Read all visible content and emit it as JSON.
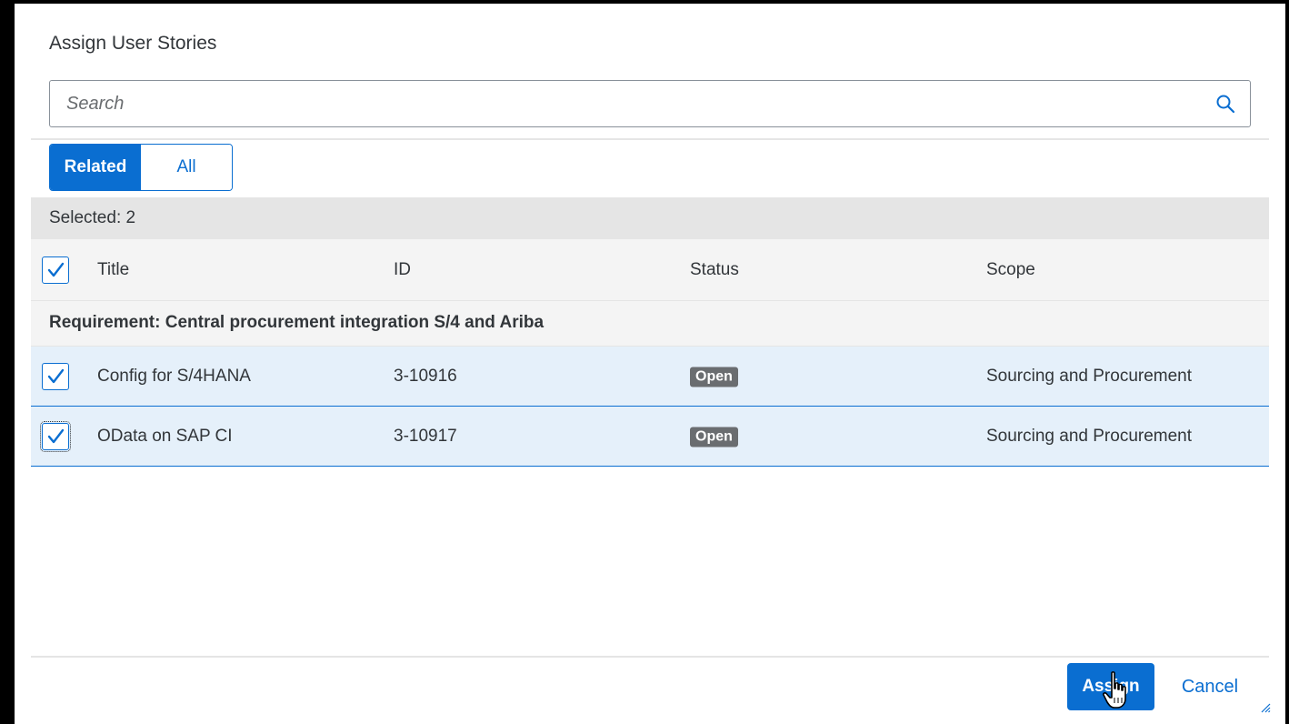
{
  "dialog": {
    "title": "Assign User Stories"
  },
  "search": {
    "placeholder": "Search",
    "value": ""
  },
  "filter": {
    "segments": [
      "Related",
      "All"
    ],
    "selected": "Related"
  },
  "selection": {
    "label": "Selected: 2"
  },
  "table": {
    "columns": {
      "title": "Title",
      "id": "ID",
      "status": "Status",
      "scope": "Scope"
    },
    "select_all_checked": true,
    "group": {
      "label": "Requirement: Central procurement integration S/4 and Ariba"
    },
    "rows": [
      {
        "title": "Config for S/4HANA",
        "id": "3-10916",
        "status": "Open",
        "scope": "Sourcing and Procurement",
        "checked": true
      },
      {
        "title": "OData on SAP CI",
        "id": "3-10917",
        "status": "Open",
        "scope": "Sourcing and Procurement",
        "checked": true
      }
    ]
  },
  "footer": {
    "assign_label": "Assign",
    "cancel_label": "Cancel"
  },
  "colors": {
    "accent": "#0a6ed1",
    "selected_row": "#e5f0fa",
    "status_badge": "#6a6d70"
  },
  "icons": {
    "search": "search-icon",
    "check": "check-icon",
    "resize": "resize-handle-icon",
    "cursor": "hand-pointer-cursor"
  }
}
